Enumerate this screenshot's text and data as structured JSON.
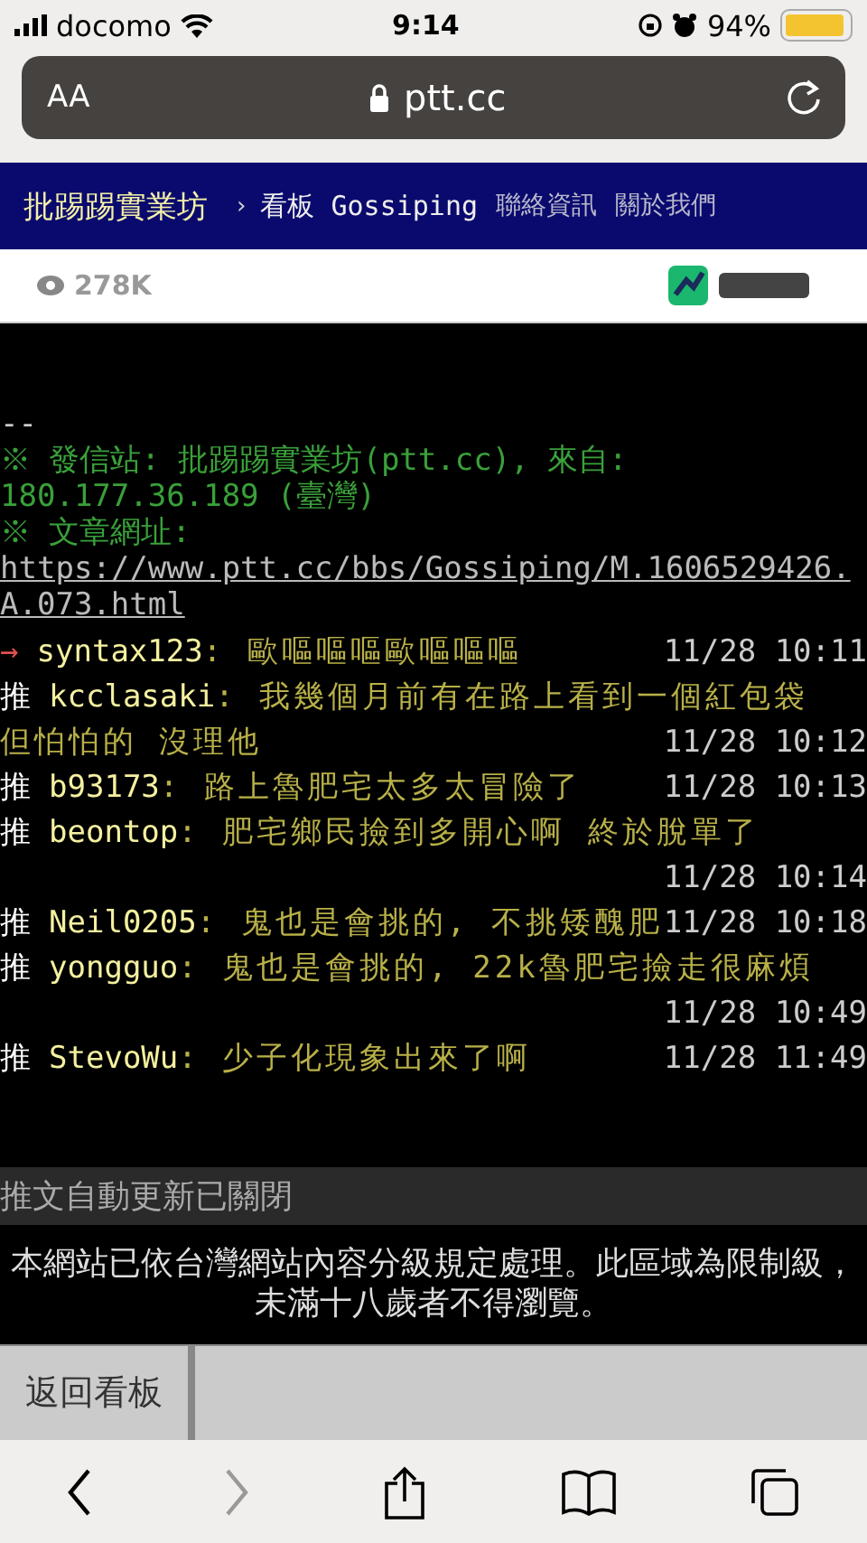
{
  "status_bar": {
    "carrier": "docomo",
    "time": "9:14",
    "battery": "94%"
  },
  "address_bar": {
    "text_size": "AA",
    "url": "ptt.cc"
  },
  "nav": {
    "site": "批踢踢實業坊",
    "separator": "›",
    "board": "看板 Gossiping",
    "links": [
      "聯絡資訊",
      "關於我們"
    ]
  },
  "embed": {
    "views": "278K"
  },
  "signature": [
    {
      "kind": "plain",
      "text": "--"
    },
    {
      "kind": "info",
      "text": "※ 發信站: 批踢踢實業坊(ptt.cc), 來自:"
    },
    {
      "kind": "info",
      "text": "180.177.36.189 (臺灣)"
    },
    {
      "kind": "info",
      "text": "※ 文章網址:"
    },
    {
      "kind": "link",
      "text": "https://www.ptt.cc/bbs/Gossiping/M.1606529426.A.073.html"
    }
  ],
  "comments": [
    {
      "kind": "arrow",
      "tag": "→",
      "user": "syntax123",
      "content_lines": [
        ": 歐嘔嘔嘔歐嘔嘔嘔"
      ],
      "time": "11/28 10:11"
    },
    {
      "kind": "push",
      "tag": "推",
      "user": "kcclasaki",
      "content_lines": [
        ": 我幾個月前有在路上看到一個紅包袋",
        "但怕怕的 沒理他"
      ],
      "time": "11/28 10:12"
    },
    {
      "kind": "push",
      "tag": "推",
      "user": "b93173",
      "content_lines": [
        ": 路上魯肥宅太多太冒險了"
      ],
      "time": "11/28 10:13"
    },
    {
      "kind": "push",
      "tag": "推",
      "user": "beontop",
      "content_lines": [
        ": 肥宅鄉民撿到多開心啊 終於脫單了"
      ],
      "time": "11/28 10:14"
    },
    {
      "kind": "push",
      "tag": "推",
      "user": "Neil0205",
      "content_lines": [
        ": 鬼也是會挑的, 不挑矮醜肥"
      ],
      "time": "11/28 10:18"
    },
    {
      "kind": "push",
      "tag": "推",
      "user": "yongguo",
      "content_lines": [
        ": 鬼也是會挑的, 22k魯肥宅撿走很麻煩"
      ],
      "time": "11/28 10:49"
    },
    {
      "kind": "push",
      "tag": "推",
      "user": "StevoWu",
      "content_lines": [
        ": 少子化現象出來了啊"
      ],
      "time": "11/28 11:49"
    }
  ],
  "auto_update": "推文自動更新已關閉",
  "notice": "本網站已依台灣網站內容分級規定處理。此區域為限制級，未滿十八歲者不得瀏覽。",
  "back_button": "返回看板",
  "toolbar": {
    "forward_disabled": true
  }
}
